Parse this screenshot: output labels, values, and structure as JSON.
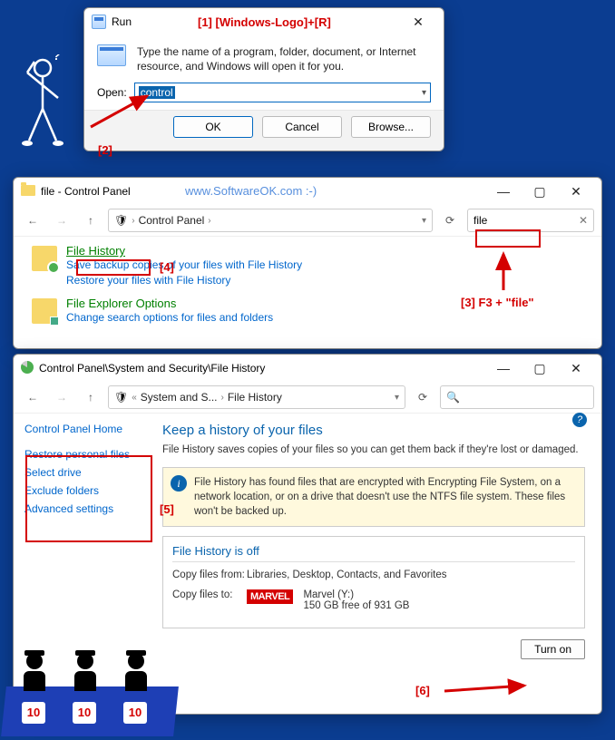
{
  "annotations": {
    "a1": "[1]  [Windows-Logo]+[R]",
    "a2": "[2]",
    "a3": "[3] F3 + \"file\"",
    "a4": "[4]",
    "a5": "[5]",
    "a6": "[6]",
    "watermark": "www.SoftwareOK.com :-)"
  },
  "run": {
    "title": "Run",
    "description": "Type the name of a program, folder, document, or Internet resource, and Windows will open it for you.",
    "open_label": "Open:",
    "value": "control",
    "ok": "OK",
    "cancel": "Cancel",
    "browse": "Browse..."
  },
  "cp_search": {
    "title": "file - Control Panel",
    "breadcrumb": "Control Panel",
    "search_value": "file",
    "results": [
      {
        "title": "File History",
        "links": [
          "Save backup copies of your files with File History",
          "Restore your files with File History"
        ]
      },
      {
        "title": "File Explorer Options",
        "links": [
          "Change search options for files and folders"
        ]
      }
    ]
  },
  "fh": {
    "title": "Control Panel\\System and Security\\File History",
    "crumb1": "System and S...",
    "crumb2": "File History",
    "sidebar": {
      "home": "Control Panel Home",
      "opts": [
        "Restore personal files",
        "Select drive",
        "Exclude folders",
        "Advanced settings"
      ]
    },
    "heading": "Keep a history of your files",
    "sub": "File History saves copies of your files so you can get them back if they're lost or damaged.",
    "warn": "File History has found files that are encrypted with Encrypting File System, on a network location, or on a drive that doesn't use the NTFS file system. These files won't be backed up.",
    "status_heading": "File History is off",
    "copy_from_label": "Copy files from:",
    "copy_from_value": "Libraries, Desktop, Contacts, and Favorites",
    "copy_to_label": "Copy files to:",
    "drive_brand": "MARVEL",
    "drive_name": "Marvel (Y:)",
    "drive_free": "150 GB free of 931 GB",
    "turn_on": "Turn on"
  },
  "judges": {
    "score": "10"
  }
}
